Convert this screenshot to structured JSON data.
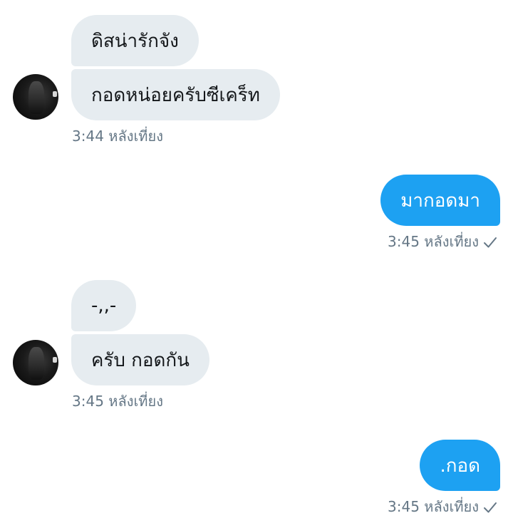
{
  "conversation": {
    "group1": {
      "messages": [
        "ดิสน่ารักจัง",
        "กอดหน่อยครับซีเคร็ท"
      ],
      "timestamp": "3:44 หลังเที่ยง"
    },
    "reply1": {
      "message": "มากอดมา",
      "timestamp": "3:45 หลังเที่ยง"
    },
    "group2": {
      "messages": [
        "-,,-",
        "ครับ กอดกัน"
      ],
      "timestamp": "3:45 หลังเที่ยง"
    },
    "reply2": {
      "message": ".กอด",
      "timestamp": "3:45 หลังเที่ยง"
    }
  },
  "colors": {
    "incoming_bubble": "#e6ecf0",
    "outgoing_bubble": "#1da1f2",
    "meta_text": "#657786"
  },
  "icons": {
    "sent": "checkmark-icon",
    "avatar": "user-avatar"
  }
}
